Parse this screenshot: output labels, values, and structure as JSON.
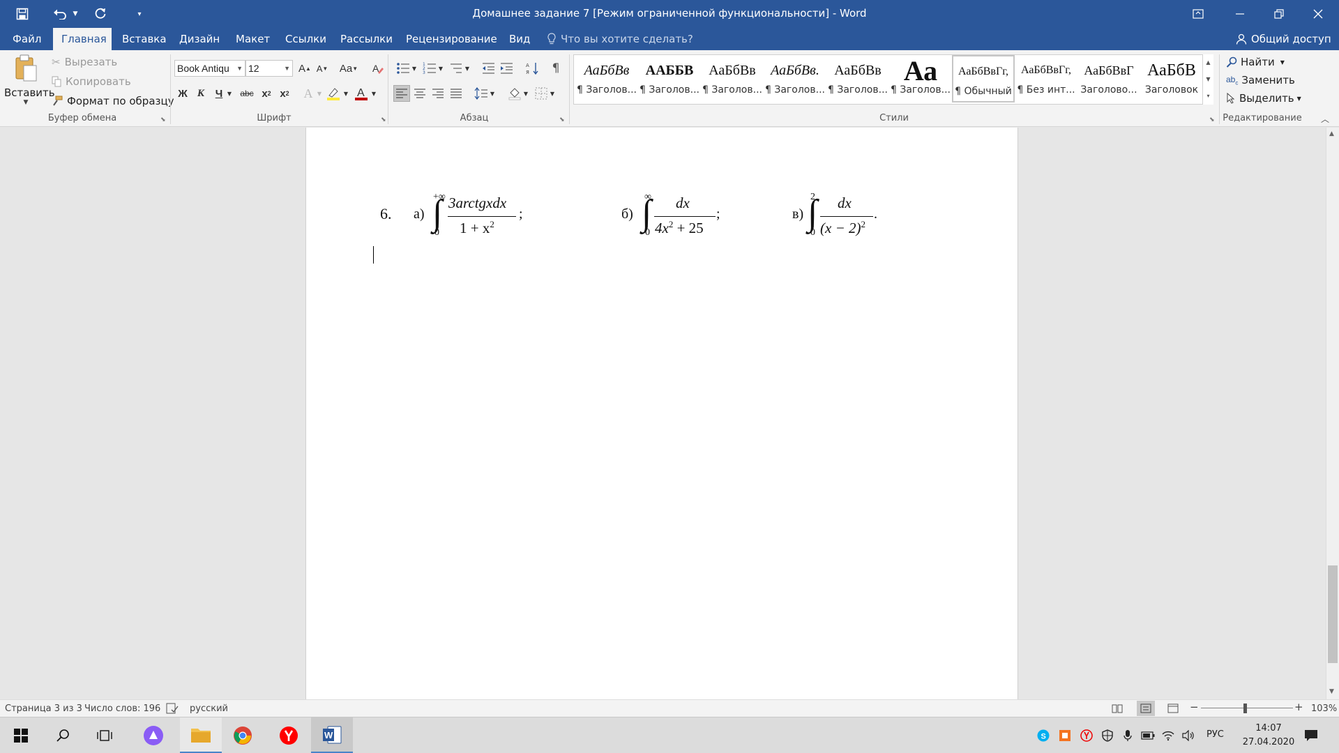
{
  "window": {
    "title": "Домашнее задание 7 [Режим ограниченной функциональности] - Word",
    "accent": "#2b579a"
  },
  "tabs": [
    "Файл",
    "Главная",
    "Вставка",
    "Дизайн",
    "Макет",
    "Ссылки",
    "Рассылки",
    "Рецензирование",
    "Вид"
  ],
  "tell_me": "Что вы хотите сделать?",
  "share": "Общий доступ",
  "clipboard": {
    "paste": "Вставить",
    "cut": "Вырезать",
    "copy": "Копировать",
    "format_painter": "Формат по образцу",
    "label": "Буфер обмена"
  },
  "font": {
    "name": "Book Antiqu",
    "size": "12",
    "label": "Шрифт",
    "bold": "Ж",
    "italic": "К",
    "underline": "Ч",
    "strike": "abc",
    "case": "Aa"
  },
  "paragraph": {
    "label": "Абзац"
  },
  "styles": {
    "label": "Стили",
    "items": [
      {
        "sample": "АаБбВв",
        "name": "¶ Заголов..."
      },
      {
        "sample": "ААББВ",
        "name": "¶ Заголов..."
      },
      {
        "sample": "АаБбВв",
        "name": "¶ Заголов..."
      },
      {
        "sample": "АаБбВв.",
        "name": "¶ Заголов..."
      },
      {
        "sample": "АаБбВв",
        "name": "¶ Заголов..."
      },
      {
        "sample": "Аа",
        "name": "¶ Заголов..."
      },
      {
        "sample": "АаБбВвГг,",
        "name": "¶ Обычный"
      },
      {
        "sample": "АаБбВвГг,",
        "name": "¶ Без инт..."
      },
      {
        "sample": "АаБбВвГ",
        "name": "Заголово..."
      },
      {
        "sample": "АаБбВ",
        "name": "Заголовок"
      }
    ]
  },
  "editing": {
    "find": "Найти",
    "replace": "Заменить",
    "select": "Выделить",
    "label": "Редактирование"
  },
  "document": {
    "problem_number": "6.",
    "a": {
      "label": "а)",
      "upper": "+∞",
      "lower": "0",
      "numerator": "3arctgxdx",
      "denominator_base": "1 + x",
      "denominator_exp": "2",
      "end": ";"
    },
    "b": {
      "label": "б)",
      "upper": "∞",
      "lower": "0",
      "numerator": "dx",
      "denominator_base": "4x",
      "denominator_exp": "2",
      "denominator_rest": "+ 25",
      "end": ";"
    },
    "c": {
      "label": "в)",
      "upper": "2",
      "lower": "0",
      "numerator": "dx",
      "denominator_base": "(x − 2)",
      "denominator_exp": "2",
      "end": "."
    }
  },
  "status": {
    "page": "Страница 3 из 3",
    "words": "Число слов: 196",
    "language": "русский",
    "zoom": "103%"
  },
  "taskbar": {
    "lang": "РУС",
    "time": "14:07",
    "date": "27.04.2020"
  }
}
